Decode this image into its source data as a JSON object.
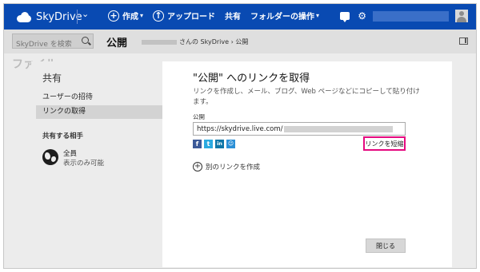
{
  "header": {
    "brand": "SkyDrive",
    "menu": [
      {
        "label": "作成",
        "icon": "plus-circle-icon",
        "has_dropdown": true
      },
      {
        "label": "アップロード",
        "icon": "upload-icon",
        "has_dropdown": false
      },
      {
        "label": "共有",
        "icon": "",
        "has_dropdown": false
      },
      {
        "label": "フォルダーの操作",
        "icon": "",
        "has_dropdown": true
      }
    ],
    "chevron": "⌄",
    "dropdown_glyph": "▾",
    "right_icons": [
      "chat-icon",
      "gear-icon",
      "user-avatar"
    ]
  },
  "subbar": {
    "search_placeholder": "SkyDrive を検索",
    "title": "公開",
    "breadcrumb": "さんの SkyDrive › 公開"
  },
  "background": {
    "partial_text": "ファイル"
  },
  "dialog": {
    "sidebar": {
      "heading": "共有",
      "items": [
        {
          "label": "ユーザーの招待"
        },
        {
          "label": "リンクの取得"
        }
      ],
      "group_title": "共有する相手",
      "permission": {
        "name": "全員",
        "description": "表示のみ可能"
      }
    },
    "main": {
      "title": "\"公開\" へのリンクを取得",
      "description": "リンクを作成し、メール、ブログ、Web ページなどにコピーして貼り付けます。",
      "field_label": "公開",
      "link_value": "https://skydrive.live.com/",
      "social_icons": [
        "facebook-icon",
        "twitter-icon",
        "linkedin-icon",
        "messenger-icon"
      ],
      "shorten_label": "リンクを短縮",
      "add_link_label": "別のリンクを作成",
      "close_label": "閉じる"
    }
  },
  "colors": {
    "topbar": "#094ab2",
    "highlight": "#e5097f"
  }
}
